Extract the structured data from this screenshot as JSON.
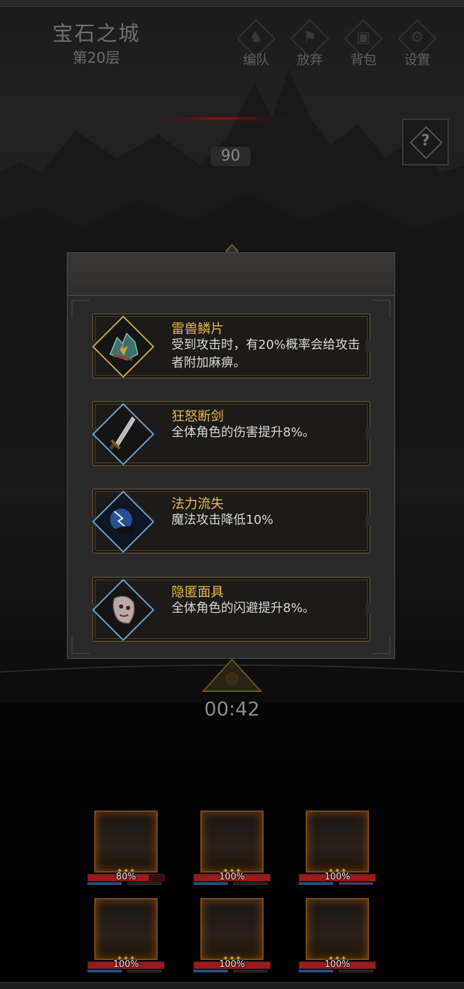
{
  "dungeon": {
    "name": "宝石之城",
    "floor": "第20层"
  },
  "menu": [
    {
      "label": "编队",
      "icon": "team-icon"
    },
    {
      "label": "放弃",
      "icon": "flag-icon"
    },
    {
      "label": "背包",
      "icon": "bag-icon"
    },
    {
      "label": "设置",
      "icon": "gear-icon"
    }
  ],
  "help": {
    "symbol": "?"
  },
  "score": "90",
  "timer": "00:42",
  "relics": [
    {
      "name": "雷兽鳞片",
      "desc": "受到攻击时，有20%概率会给攻击者附加麻痹。",
      "rarity": "gold",
      "icon": "thunder-scale-icon"
    },
    {
      "name": "狂怒断剑",
      "desc": "全体角色的伤害提升8%。",
      "rarity": "blue",
      "icon": "broken-sword-icon"
    },
    {
      "name": "法力流失",
      "desc": "魔法攻击降低10%",
      "rarity": "blue",
      "icon": "mana-drain-icon"
    },
    {
      "name": "隐匿面具",
      "desc": "全体角色的闪避提升8%。",
      "rarity": "blue",
      "icon": "mask-icon"
    }
  ],
  "heroes": [
    {
      "hp": "80%",
      "hp_fraction": 0.8
    },
    {
      "hp": "100%",
      "hp_fraction": 1.0
    },
    {
      "hp": "100%",
      "hp_fraction": 1.0
    },
    {
      "hp": "100%",
      "hp_fraction": 1.0
    },
    {
      "hp": "100%",
      "hp_fraction": 1.0
    },
    {
      "hp": "100%",
      "hp_fraction": 1.0
    }
  ],
  "colors": {
    "accent_gold": "#e6b54a",
    "rare_blue": "#6ea0c8",
    "hp_red": "#9a1b1b"
  }
}
